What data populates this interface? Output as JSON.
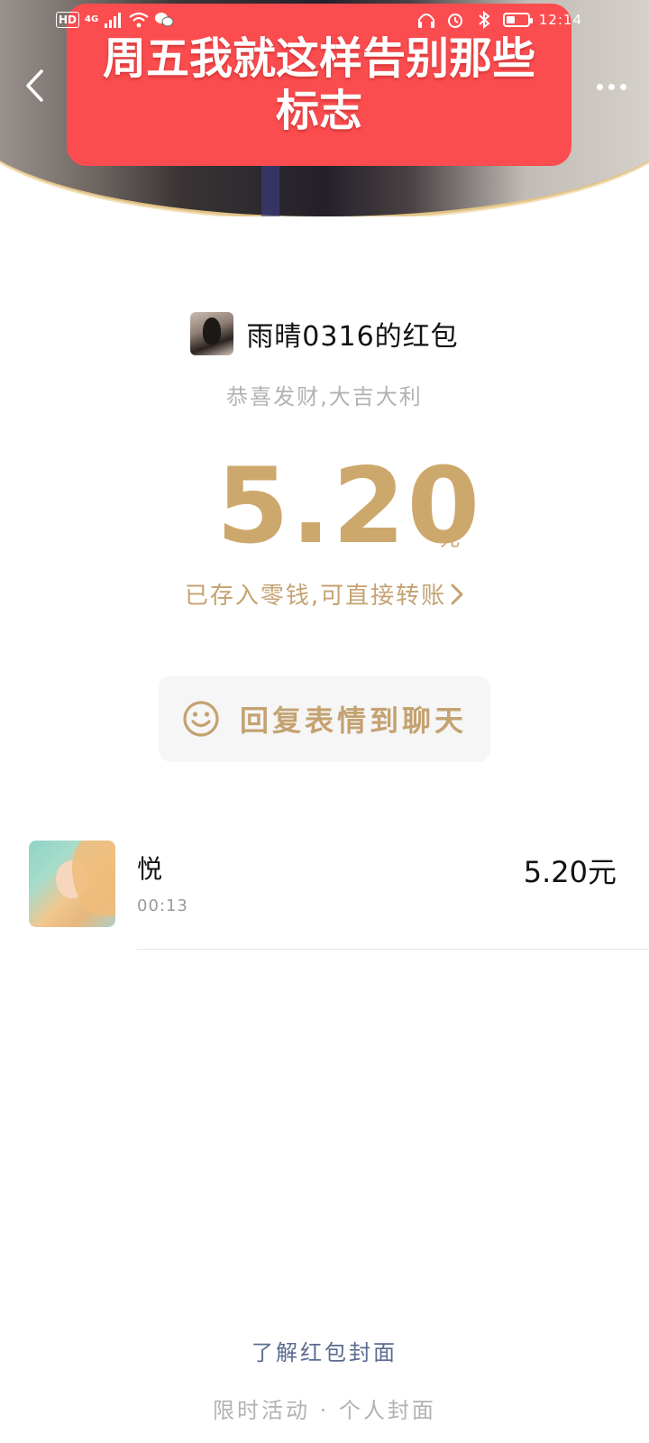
{
  "status_bar": {
    "hd": "HD",
    "network": "4G",
    "time": "12:14",
    "battery_fraction": 0.4
  },
  "header": {
    "banner_text": "周五我就这样告别那些标志",
    "back_icon": "chevron-left-icon",
    "more_icon": "more-dots-icon"
  },
  "packet": {
    "sender_name": "雨晴0316的红包",
    "wishes": "恭喜发财,大吉大利",
    "amount": "5.20",
    "unit": "元",
    "saved_text": "已存入零钱,可直接转账",
    "reply_label": "回复表情到聊天",
    "accent_color": "#cda86c"
  },
  "receivers": [
    {
      "name": "悦",
      "time": "00:13",
      "amount": "5.20元"
    }
  ],
  "footer": {
    "cover_link": "了解红包封面",
    "promo": "限时活动 · 个人封面"
  }
}
